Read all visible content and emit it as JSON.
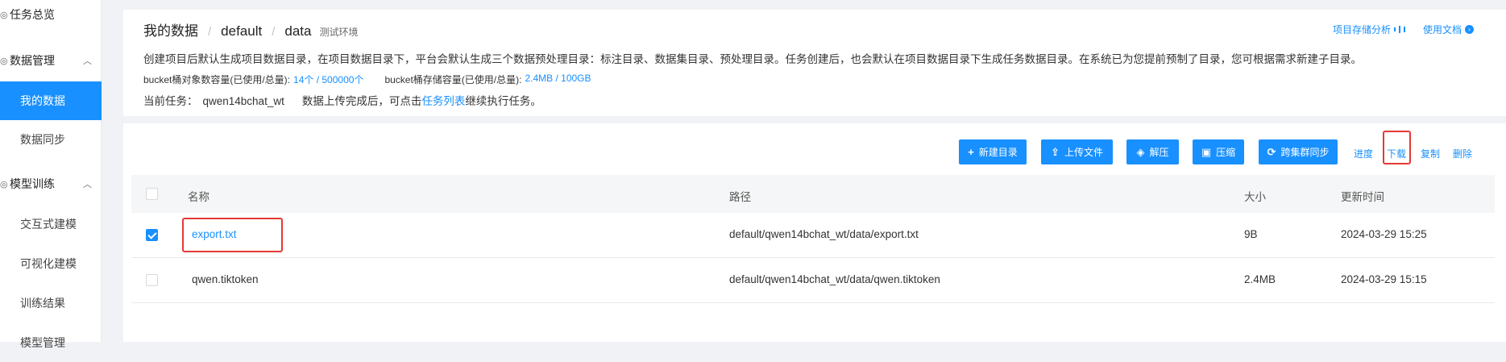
{
  "sidebar": {
    "groups": [
      {
        "label": "任务总览",
        "icon": "overview-icon"
      },
      {
        "label": "数据管理",
        "icon": "data-icon",
        "chevron": "chevron-up-icon"
      },
      {
        "label": "模型训练",
        "icon": "model-icon",
        "chevron": "chevron-up-icon"
      }
    ],
    "items": [
      {
        "label": "我的数据",
        "active": true
      },
      {
        "label": "数据同步"
      },
      {
        "label": "交互式建模"
      },
      {
        "label": "可视化建模"
      },
      {
        "label": "训练结果"
      },
      {
        "label": "模型管理"
      }
    ]
  },
  "header": {
    "breadcrumb": [
      "我的数据",
      "default",
      "data"
    ],
    "separator": "/",
    "env": "测试环境",
    "links": {
      "analysis": "项目存储分析",
      "docs": "使用文档"
    },
    "description": "创建项目后默认生成项目数据目录，在项目数据目录下，平台会默认生成三个数据预处理目录：标注目录、数据集目录、预处理目录。任务创建后，也会默认在项目数据目录下生成任务数据目录。在系统已为您提前预制了目录，您可根据需求新建子目录。",
    "quota": {
      "objects_label": "bucket桶对象数容量(已使用/总量):",
      "objects_value": "14个 / 500000个",
      "storage_label": "bucket桶存储容量(已使用/总量):",
      "storage_value": "2.4MB / 100GB"
    },
    "current_task": {
      "label": "当前任务：",
      "name": "qwen14bchat_wt",
      "hint_before": "数据上传完成后，可点击",
      "link": "任务列表",
      "hint_after": "继续执行任务。"
    }
  },
  "toolbar": {
    "new_dir": "新建目录",
    "upload": "上传文件",
    "unzip": "解压",
    "zip": "压缩",
    "sync": "跨集群同步",
    "progress": "进度",
    "download": "下载",
    "copy": "复制",
    "delete": "删除"
  },
  "table": {
    "columns": [
      "名称",
      "路径",
      "大小",
      "更新时间"
    ],
    "rows": [
      {
        "name": "export.txt",
        "path": "default/qwen14bchat_wt/data/export.txt",
        "size": "9B",
        "updated": "2024-03-29 15:25",
        "checked": true
      },
      {
        "name": "qwen.tiktoken",
        "path": "default/qwen14bchat_wt/data/qwen.tiktoken",
        "size": "2.4MB",
        "updated": "2024-03-29 15:15",
        "checked": false
      }
    ]
  },
  "colors": {
    "accent": "#1890ff",
    "highlight": "#e53935"
  }
}
